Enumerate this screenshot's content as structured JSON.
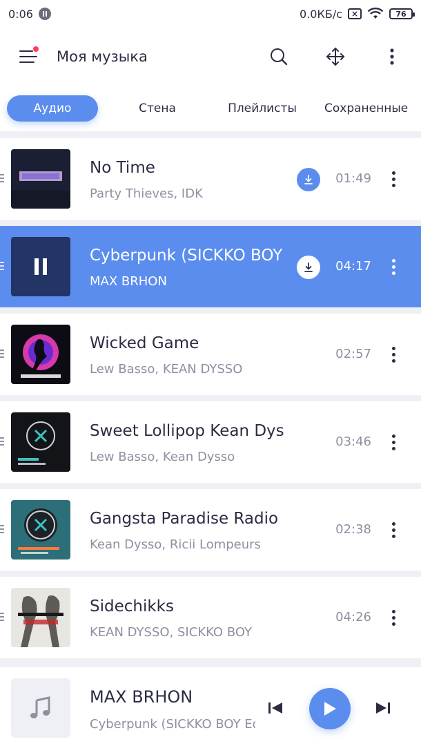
{
  "status_bar": {
    "time": "0:06",
    "net_speed": "0.0КБ/с",
    "battery": "76"
  },
  "app_bar": {
    "title": "Моя музыка",
    "icons": [
      "menu-icon",
      "search-icon",
      "move-icon",
      "more-icon"
    ]
  },
  "tabs": [
    {
      "label": "Аудио",
      "active": true
    },
    {
      "label": "Стена",
      "active": false
    },
    {
      "label": "Плейлисты",
      "active": false
    },
    {
      "label": "Сохраненные",
      "active": false
    }
  ],
  "tracks": [
    {
      "title": "No Time",
      "artist": "Party Thieves, IDK",
      "duration": "01:49",
      "downloadable": true,
      "playing": false
    },
    {
      "title": "Cyberpunk (SICKKO BOY Edit)",
      "artist": "MAX BRHON",
      "duration": "04:17",
      "downloadable": true,
      "playing": true
    },
    {
      "title": "Wicked Game",
      "artist": "Lew Basso, KEAN DYSSO",
      "duration": "02:57",
      "downloadable": false,
      "playing": false
    },
    {
      "title": "Sweet Lollipop Kean Dysso",
      "artist": "Lew Basso, Kean Dysso",
      "duration": "03:46",
      "downloadable": false,
      "playing": false
    },
    {
      "title": "Gangsta Paradise Radio Edit",
      "artist": "Kean Dysso, Ricii Lompeurs",
      "duration": "02:38",
      "downloadable": false,
      "playing": false
    },
    {
      "title": "Sidechikks",
      "artist": "KEAN DYSSO, SICKKO BOY",
      "duration": "04:26",
      "downloadable": false,
      "playing": false
    }
  ],
  "player": {
    "title": "MAX BRHON",
    "artist": "Cyberpunk (SICKKO BOY Edit)"
  },
  "colors": {
    "accent": "#5b8def",
    "text": "#2b2d42",
    "muted": "#8d90a0",
    "background": "#eef0f5",
    "badge_dot": "#ff3b5c"
  }
}
